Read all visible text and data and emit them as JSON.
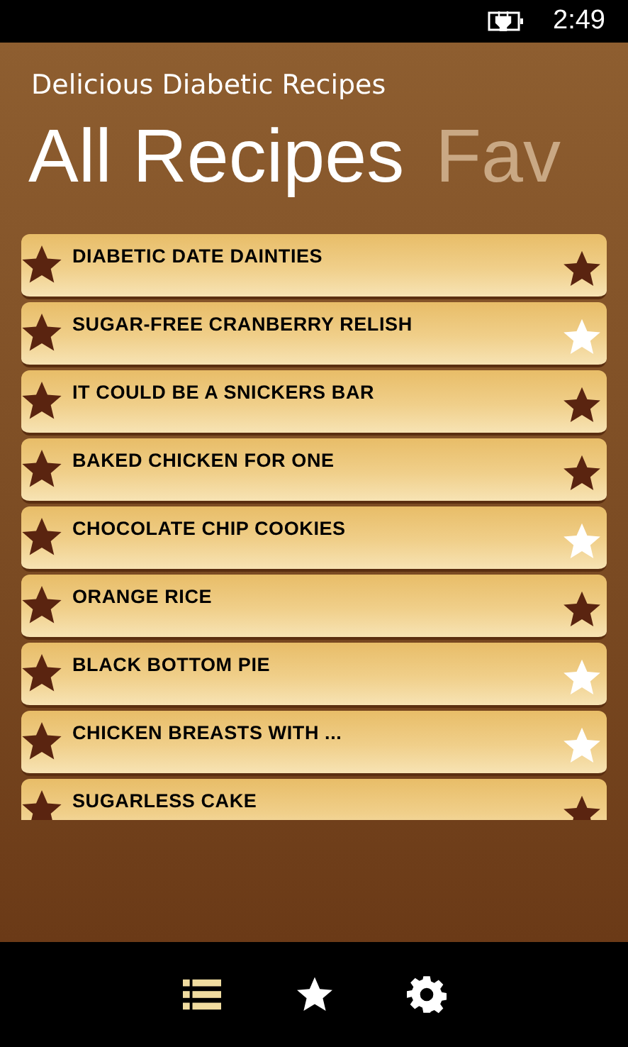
{
  "status_bar": {
    "time": "2:49"
  },
  "app_title": "Delicious Diabetic Recipes",
  "pivots": [
    {
      "label": "All Recipes",
      "selected": true
    },
    {
      "label": "Fav",
      "selected": false
    }
  ],
  "recipes": [
    {
      "name": "DIABETIC DATE DAINTIES",
      "favorite": true
    },
    {
      "name": "SUGAR-FREE CRANBERRY RELISH",
      "favorite": false
    },
    {
      "name": "IT COULD BE A SNICKERS BAR",
      "favorite": true
    },
    {
      "name": "BAKED CHICKEN FOR ONE",
      "favorite": true
    },
    {
      "name": "CHOCOLATE CHIP COOKIES",
      "favorite": false
    },
    {
      "name": "ORANGE RICE",
      "favorite": true
    },
    {
      "name": "BLACK BOTTOM PIE",
      "favorite": false
    },
    {
      "name": "CHICKEN BREASTS WITH ...",
      "favorite": false
    },
    {
      "name": "SUGARLESS CAKE",
      "favorite": true
    }
  ],
  "app_bar": [
    {
      "kind": "list",
      "selected": true
    },
    {
      "kind": "star",
      "selected": false
    },
    {
      "kind": "settings",
      "selected": false
    }
  ]
}
